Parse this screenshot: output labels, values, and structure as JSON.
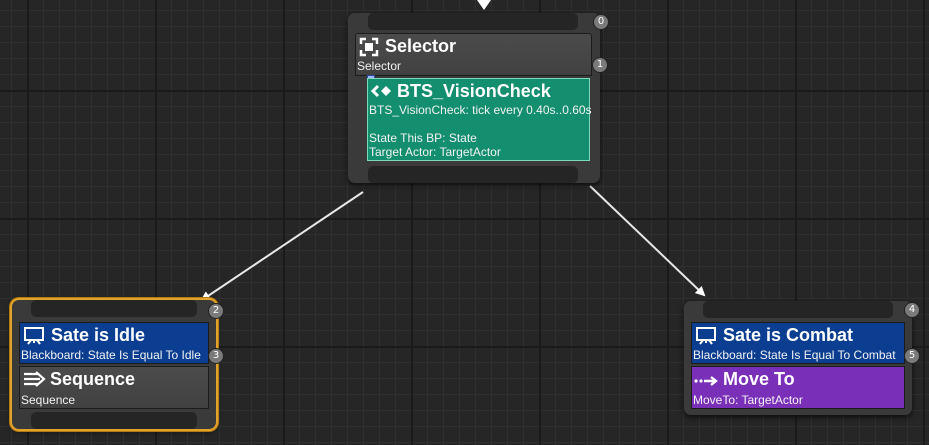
{
  "colors": {
    "background": "#262626",
    "node_body": "#3a3a3a",
    "service": "#138e6e",
    "decorator": "#0b3e91",
    "task": "#7a2fb8",
    "selection": "#e3a32a"
  },
  "nodes": {
    "selector": {
      "title": "Selector",
      "subtitle": "Selector",
      "index": "1",
      "root_index": "0",
      "icon": "selector-icon",
      "service": {
        "title": "BTS_VisionCheck",
        "line1": "BTS_VisionCheck: tick every 0.40s..0.60s",
        "line2": "State This BP: State",
        "line3": "Target Actor: TargetActor",
        "icon": "service-icon"
      }
    },
    "idle_branch": {
      "selected": true,
      "index": "2",
      "decorator": {
        "title": "Sate is Idle",
        "subtitle": "Blackboard: State Is Equal To Idle",
        "index": "3",
        "icon": "blackboard-icon"
      },
      "composite": {
        "title": "Sequence",
        "subtitle": "Sequence",
        "icon": "sequence-icon"
      }
    },
    "combat_branch": {
      "selected": false,
      "index": "4",
      "decorator": {
        "title": "Sate is Combat",
        "subtitle": "Blackboard: State Is Equal To Combat",
        "index": "5",
        "icon": "blackboard-icon"
      },
      "task": {
        "title": "Move To",
        "subtitle": "MoveTo: TargetActor",
        "icon": "move-to-icon"
      }
    }
  }
}
